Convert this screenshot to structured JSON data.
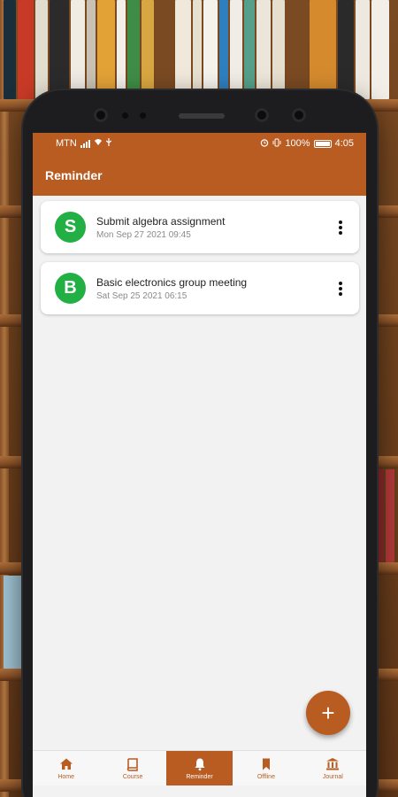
{
  "status_bar": {
    "carrier": "MTN",
    "battery": "100%",
    "time": "4:05"
  },
  "app_bar": {
    "title": "Reminder"
  },
  "reminders": [
    {
      "initial": "S",
      "title": "Submit algebra assignment",
      "date": "Mon Sep 27 2021 09:45"
    },
    {
      "initial": "B",
      "title": "Basic electronics group meeting",
      "date": "Sat Sep 25 2021 06:15"
    }
  ],
  "fab": {
    "label": "+"
  },
  "bottom_nav": {
    "items": [
      {
        "label": "Home",
        "icon": "home-icon"
      },
      {
        "label": "Course",
        "icon": "book-icon"
      },
      {
        "label": "Reminder",
        "icon": "bell-icon",
        "active": true
      },
      {
        "label": "Offline",
        "icon": "bookmark-icon"
      },
      {
        "label": "Journal",
        "icon": "library-icon"
      }
    ]
  },
  "colors": {
    "accent": "#b85c22",
    "avatar": "#22b045",
    "background": "#f2f2f2"
  }
}
